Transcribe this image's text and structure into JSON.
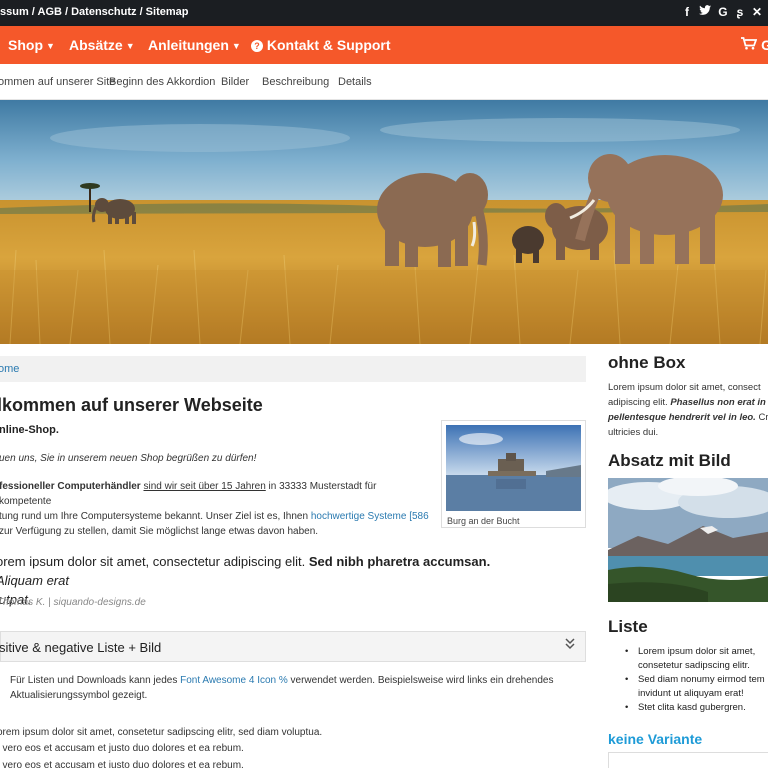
{
  "topbar": {
    "links": "ssum / AGB / Datenschutz / Sitemap",
    "social_icons": [
      {
        "icon": "facebook-icon",
        "glyph": "f"
      },
      {
        "icon": "twitter-icon",
        "glyph": "t"
      },
      {
        "icon": "google-icon",
        "glyph": "G"
      },
      {
        "icon": "stumbleupon-icon",
        "glyph": "s"
      },
      {
        "icon": "xing-icon",
        "glyph": "x"
      }
    ]
  },
  "mainnav": {
    "items": [
      "Shop",
      "Absätze",
      "Anleitungen",
      "Kontakt & Support"
    ],
    "cart_label": "G",
    "bg_color": "#f5582a"
  },
  "subnav": {
    "items": [
      "ommen auf unserer Site",
      "Beginn des Akkordion",
      "Bilder",
      "Beschreibung",
      "Details"
    ]
  },
  "breadcrumb": "ome",
  "main": {
    "title": "lkommen auf unserer Webseite",
    "line1": "nline-Shop.",
    "line2": "uen uns, Sie in unserem neuen Shop begrüßen zu dürfen!",
    "para_bold": "fessioneller Computerhändler",
    "para_underline": "sind wir seit über 15 Jahren",
    "para_mid": " in 33333 Musterstadt für kompetente",
    "para_line2": "tung rund um Ihre Computersysteme bekannt. Unser Ziel ist es, Ihnen ",
    "para_link": "hochwertige Systeme [586",
    "para_line3": "zur Verfügung zu stellen, damit Sie möglichst lange etwas davon haben.",
    "figure_caption": "Burg an der Bucht",
    "quote_normal": "orem ipsum dolor sit amet, consectetur adipiscing elit. ",
    "quote_bold": "Sed nibh pharetra accumsan.",
    "quote_italic": " Aliquam erat",
    "quote_line2": "lutpat.",
    "author": "Thomas K. | siquando-designs.de",
    "accordion_label": "sitive & negative Liste + Bild",
    "info_text_1": "Für Listen und Downloads kann jedes ",
    "info_link": "Font Awesome 4 Icon",
    "info_text_2": " verwendet werden. Beispielsweise wird links ein drehendes",
    "info_text_3": "Aktualisierungssymbol gezeigt.",
    "lorem1_a": "orem ipsum dolor sit amet, consetetur sadipscing elitr, sed diam voluptua.",
    "lorem1_b": "t vero eos et accusam et justo duo dolores et ea rebum.",
    "lorem2": "t vero eos et accusam et justo duo dolores et ea rebum."
  },
  "sidebar": {
    "h1": "ohne Box",
    "p1_a": "Lorem ipsum dolor sit amet, consect",
    "p1_b": "adipiscing elit. ",
    "p1_bold": "Phasellus non erat in lo",
    "p1_c": "pellentesque hendrerit vel in leo.",
    "p1_d": " Cras",
    "p1_e": "ultricies dui.",
    "h2": "Absatz mit Bild",
    "h3": "Liste",
    "list": [
      "Lorem ipsum dolor sit amet, consetetur sadipscing elitr.",
      "Sed diam nonumy eirmod tem invidunt ut aliquyam erat!",
      "Stet clita kasd gubergren."
    ],
    "h4": "keine Variante",
    "h4_color": "#1e9bd7"
  }
}
